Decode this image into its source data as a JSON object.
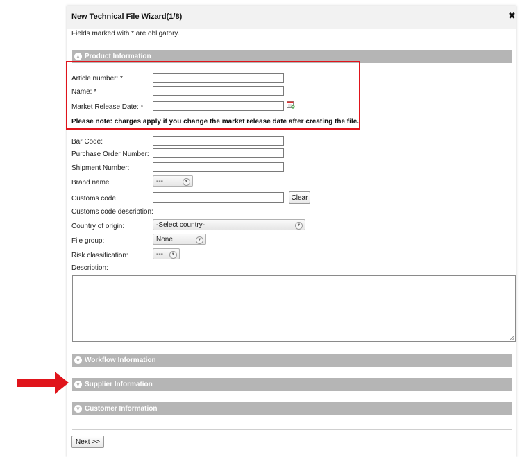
{
  "wizard": {
    "title": "New Technical File Wizard(1/8)",
    "close_glyph": "✖",
    "obligatory_note": "Fields marked with * are obligatory."
  },
  "sections": {
    "product": "Product Information",
    "workflow": "Workflow Information",
    "supplier": "Supplier Information",
    "customer": "Customer Information"
  },
  "fields": {
    "article_number": "Article number: *",
    "name": "Name: *",
    "market_release_date": "Market Release Date: *",
    "charges_note": "Please note: charges apply if you change the market release date after creating the file.",
    "bar_code": "Bar Code:",
    "purchase_order_number": "Purchase Order Number:",
    "shipment_number": "Shipment Number:",
    "brand_name": "Brand name",
    "customs_code": "Customs code",
    "customs_code_description": "Customs code description:",
    "country_of_origin": "Country of origin:",
    "file_group": "File group:",
    "risk_classification": "Risk classification:",
    "description": "Description:"
  },
  "values": {
    "article_number": "",
    "name": "",
    "market_release_date": "",
    "bar_code": "",
    "purchase_order_number": "",
    "shipment_number": "",
    "customs_code": "",
    "description": ""
  },
  "selects": {
    "brand_name": "---",
    "country_of_origin": "-Select country-",
    "file_group": "None",
    "risk_classification": "---"
  },
  "buttons": {
    "clear": "Clear",
    "next": "Next >>"
  },
  "icons": {
    "section_expanded": "circle-chevron-up-icon",
    "section_collapsed": "circle-chevron-down-icon",
    "calendar": "calendar-add-icon",
    "close": "close-icon"
  },
  "colors": {
    "section_bar": "#b5b5b5",
    "highlight_box": "#e0141b",
    "annotation_arrow": "#e0141b"
  }
}
